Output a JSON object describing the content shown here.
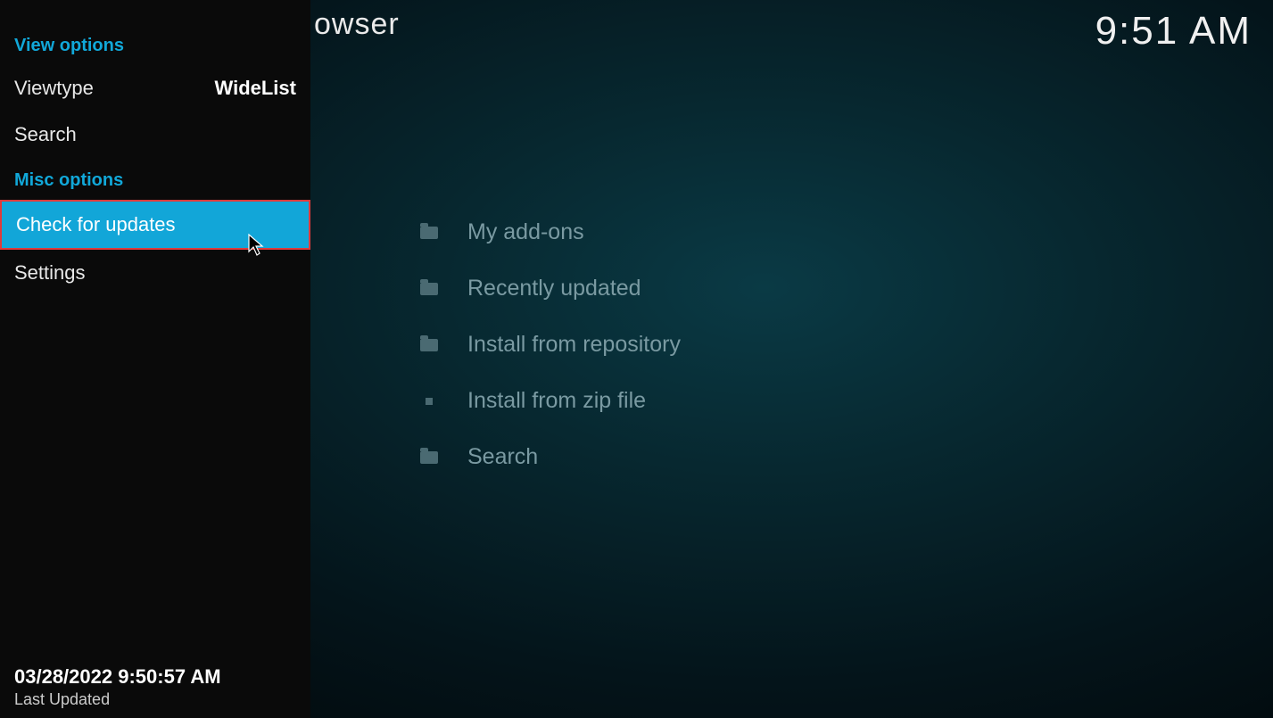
{
  "header": {
    "title_partial": "owser",
    "clock": "9:51 AM"
  },
  "sidebar": {
    "view_options_header": "View options",
    "viewtype_label": "Viewtype",
    "viewtype_value": "WideList",
    "search_label": "Search",
    "misc_options_header": "Misc options",
    "check_updates_label": "Check for updates",
    "settings_label": "Settings",
    "footer_datetime": "03/28/2022 9:50:57 AM",
    "footer_label": "Last Updated"
  },
  "main_list": {
    "items": [
      {
        "icon": "folder",
        "label": "My add-ons"
      },
      {
        "icon": "folder",
        "label": "Recently updated"
      },
      {
        "icon": "folder",
        "label": "Install from repository"
      },
      {
        "icon": "zip",
        "label": "Install from zip file"
      },
      {
        "icon": "folder",
        "label": "Search"
      }
    ]
  }
}
